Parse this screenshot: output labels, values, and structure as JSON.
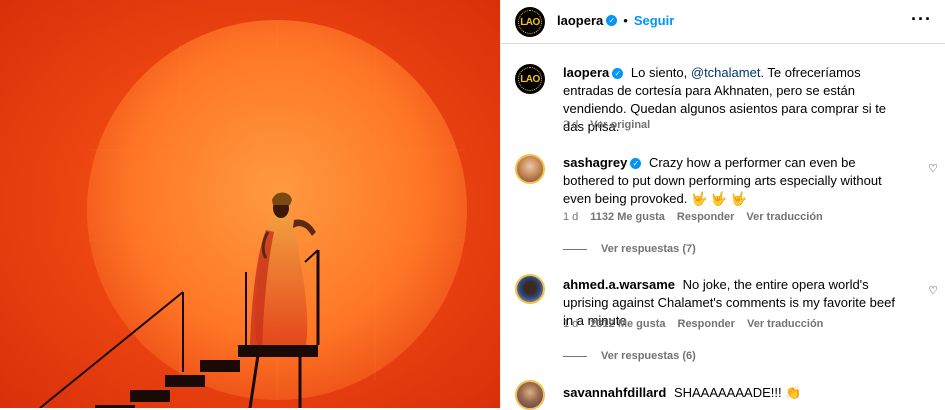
{
  "post": {
    "author": "laopera",
    "follow_label": "Seguir",
    "separator": "•",
    "more_label": "···",
    "avatar_text": "LAO"
  },
  "comments": [
    {
      "username": "laopera",
      "verified": true,
      "text_before": "Lo siento,",
      "mention": "@tchalamet",
      "text_after": ". Te ofreceríamos entradas de cortesía para Akhnaten, pero se están vendiendo. Quedan algunos asientos para comprar si te das prisa.",
      "time": "2 d",
      "action": "Ver original"
    },
    {
      "username": "sashagrey",
      "verified": true,
      "text": "Crazy how a performer can even be bothered to put down performing arts especially without even being provoked.",
      "emoji": "🤟 🤟 🤟",
      "time": "1 d",
      "likes": "1132 Me gusta",
      "reply": "Responder",
      "translate": "Ver traducción",
      "replies": "Ver respuestas (7)"
    },
    {
      "username": "ahmed.a.warsame",
      "verified": false,
      "text": "No joke, the entire opera world's uprising against Chalamet's comments is my favorite beef in a minute.",
      "time": "1 d",
      "likes": "2312 Me gusta",
      "reply": "Responder",
      "translate": "Ver traducción",
      "replies": "Ver respuestas (6)"
    },
    {
      "username": "savannahfdillard",
      "verified": false,
      "text": "SHAAAAAAADE!!!",
      "emoji": "👏"
    }
  ],
  "icons": {
    "heart": "heart-icon",
    "verified": "verified-badge-icon"
  },
  "colors": {
    "link": "#0095f6",
    "mention": "#00376b",
    "meta": "#737373",
    "photo_bg": "#f24a12",
    "sun": "#ff7a2a"
  }
}
